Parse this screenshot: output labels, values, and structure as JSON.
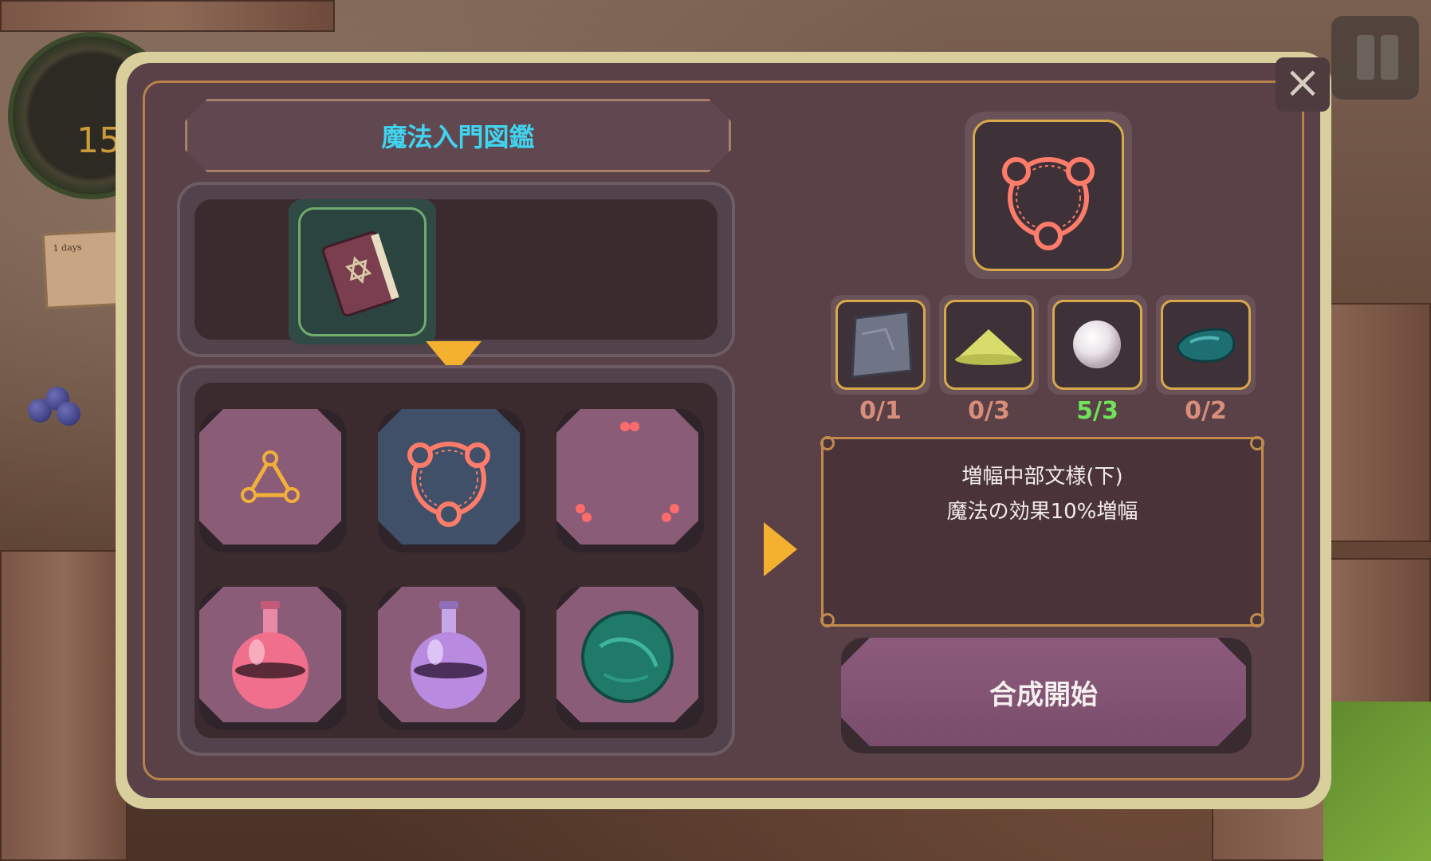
{
  "hud": {
    "day_counter": "15",
    "note_text": "1 days"
  },
  "dialog": {
    "title": "魔法入門図鑑",
    "close_label": "×",
    "selected_book": "magic-book-icon",
    "recipe_grid": [
      {
        "icon": "triangle-sigil-icon",
        "selected": false
      },
      {
        "icon": "amplify-circle-icon",
        "selected": true
      },
      {
        "icon": "red-dots-pattern-icon",
        "selected": false
      },
      {
        "icon": "pink-potion-flask-icon",
        "selected": false
      },
      {
        "icon": "purple-potion-flask-icon",
        "selected": false
      },
      {
        "icon": "green-slime-orb-icon",
        "selected": false
      }
    ],
    "result_icon": "amplify-circle-icon",
    "materials": [
      {
        "icon": "stone-tile-icon",
        "count": "0/1",
        "enough": false
      },
      {
        "icon": "yellow-powder-icon",
        "count": "0/3",
        "enough": false
      },
      {
        "icon": "pearl-icon",
        "count": "5/3",
        "enough": true
      },
      {
        "icon": "teal-gem-icon",
        "count": "0/2",
        "enough": false
      }
    ],
    "description": {
      "name": "増幅中部文様(下)",
      "effect": "魔法の効果10%増幅"
    },
    "start_button_label": "合成開始"
  },
  "colors": {
    "title": "#3fd4f0",
    "accent_arrow": "#f4b130",
    "count_ok": "#6fe35a",
    "count_short": "#d98e7a",
    "frame": "#d8cf9c",
    "panel": "#5a4148"
  }
}
